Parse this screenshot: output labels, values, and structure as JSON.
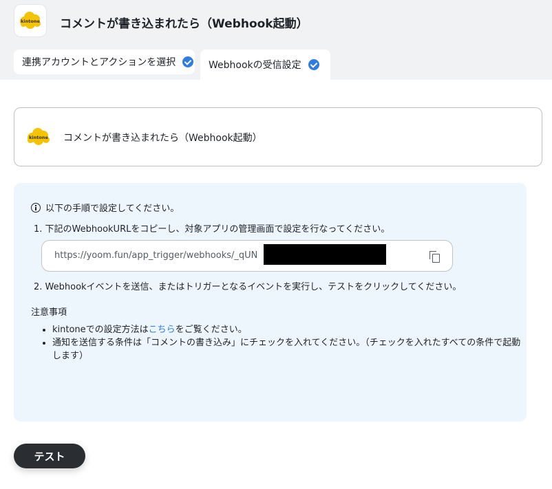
{
  "header": {
    "title": "コメントが書き込まれたら（Webhook起動）",
    "logo_text": "kintone"
  },
  "tabs": [
    {
      "label": "連携アカウントとアクションを選択",
      "completed": true
    },
    {
      "label": "Webhookの受信設定",
      "completed": true,
      "active": true
    }
  ],
  "event_card": {
    "logo_text": "kintone",
    "title": "コメントが書き込まれたら（Webhook起動）"
  },
  "instructions": {
    "heading": "以下の手順で設定してください。",
    "step1": "1. 下記のWebhookURLをコピーし、対象アプリの管理画面で設定を行なってください。",
    "url": "https://yoom.fun/app_trigger/webhooks/_qUN",
    "step2": "2. Webhookイベントを送信、またはトリガーとなるイベントを実行し、テストをクリックしてください。",
    "notes_heading": "注意事項",
    "note1_prefix": "kintoneでの設定方法は",
    "note1_link": "こちら",
    "note1_suffix": "をご覧ください。",
    "note2": "通知を送信する条件は「コメントの書き込み」にチェックを入れてください。（チェックを入れたすべての条件で起動します）"
  },
  "test_button": {
    "label": "テスト"
  },
  "colors": {
    "accent": "#2f7de1",
    "kintone_yellow": "#f5c400",
    "button_dark": "#2a2d32",
    "panel_bg": "#eef6fd"
  }
}
